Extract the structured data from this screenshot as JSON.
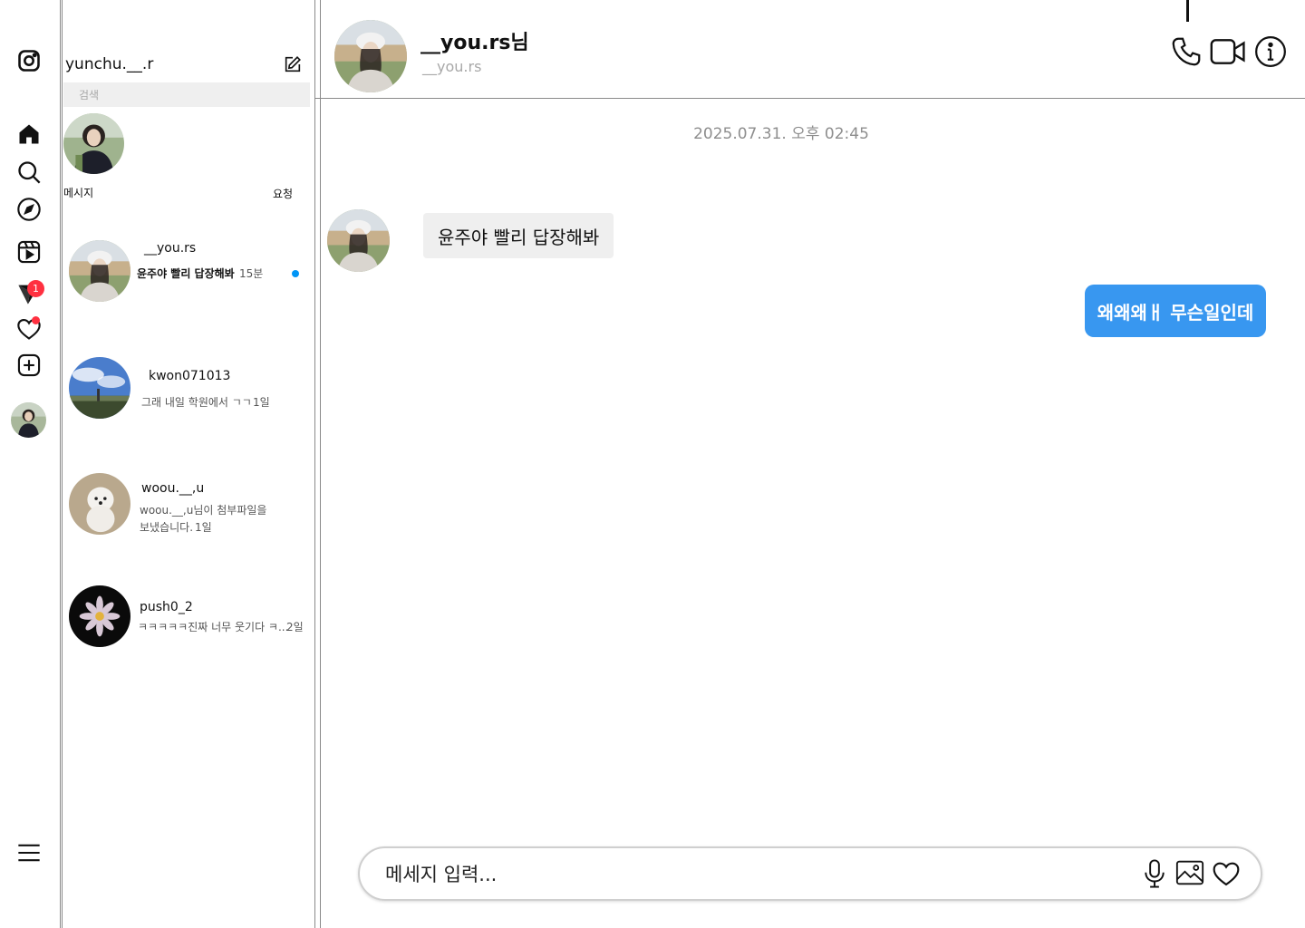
{
  "sidebar": {
    "account_name": "yunchu.__.r",
    "search_placeholder": "검색",
    "messages_label": "메시지",
    "requests_label": "요청",
    "nav": [
      {
        "icon": "instagram-logo-icon"
      },
      {
        "icon": "home-icon"
      },
      {
        "icon": "search-icon"
      },
      {
        "icon": "explore-icon"
      },
      {
        "icon": "reels-icon"
      },
      {
        "icon": "direct-messages-icon",
        "badge": "1"
      },
      {
        "icon": "notifications-heart-icon"
      },
      {
        "icon": "create-plus-icon"
      },
      {
        "icon": "profile-avatar"
      },
      {
        "icon": "menu-hamburger-icon"
      }
    ],
    "conversations": [
      {
        "username": "__you.rs",
        "preview": "윤주야 빨리 답장해봐",
        "time": "15분",
        "unread": true
      },
      {
        "username": "kwon071013",
        "preview": "그래 내일 학원에서 ㄱㄱ",
        "time": "1일",
        "unread": false
      },
      {
        "username": "woou.__,u",
        "preview_line1": "woou.__,u님이 첨부파일을",
        "preview_line2": "보냈습니다.",
        "time": "1일",
        "unread": false
      },
      {
        "username": "push0_2",
        "preview": "ㅋㅋㅋㅋㅋ진짜 너무 웃기다 ㅋ...",
        "time": "2일",
        "unread": false
      }
    ]
  },
  "chat": {
    "header_name": "__you.rs님",
    "header_handle": "__you.rs",
    "timestamp": "2025.07.31. 오후 02:45",
    "incoming_message": "윤주야 빨리 답장해봐",
    "outgoing_message": "왜왜왜ㅐ 무슨일인데",
    "input_placeholder": "메세지 입력..."
  },
  "colors": {
    "accent_blue": "#3897f0",
    "unread_dot": "#0095f6",
    "badge_red": "#ff3040",
    "incoming_bubble": "#efefef"
  }
}
